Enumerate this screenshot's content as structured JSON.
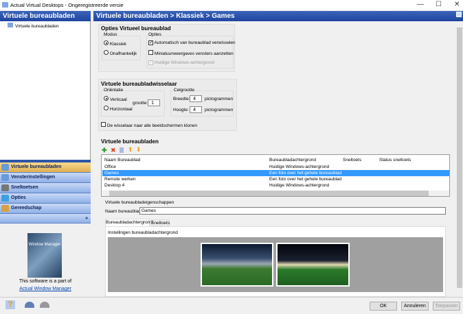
{
  "window": {
    "title": "Actual Virtual Desktops - Ongeregistreerde versie",
    "minimize": "—",
    "maximize": "☐",
    "close": "✕"
  },
  "left": {
    "header": "Virtuele bureaubladen",
    "tree_item": "Virtuele bureaubladen",
    "nav": [
      {
        "label": "Virtuele bureaubladen",
        "selected": true
      },
      {
        "label": "Vensterinstellingen"
      },
      {
        "label": "Sneltoetsen"
      },
      {
        "label": "Opties"
      },
      {
        "label": "Gereedschap"
      }
    ],
    "more": "»",
    "promo_text": "This software is a part of",
    "promo_link": "Actual Window Manager",
    "product_box": "Window Manager"
  },
  "main": {
    "breadcrumb": "Virtuele bureaubladen > Klassiek > Games",
    "group1": {
      "title": "Opties Virtueel bureaublad",
      "modus_label": "Modus",
      "modus_options": [
        "Klassiek",
        "Onafhankelijk"
      ],
      "opties_label": "Opties",
      "options": [
        {
          "label": "Automatisch van bureaublad verwisselen",
          "checked": true
        },
        {
          "label": "Miniatuurweergaves vensters aanzetten",
          "checked": false
        },
        {
          "label": "Huidige Windows-achtergrond",
          "checked": true,
          "disabled": true
        }
      ]
    },
    "group2": {
      "title": "Virtuele bureaubladwisselaar",
      "orient_label": "Oriëntatie",
      "orient_options": [
        "Verticaal",
        "Horizontaal"
      ],
      "size_label": "grootte:",
      "size_value": "1",
      "cell_label": "Celgrootte",
      "width_label": "Breedte:",
      "width_value": "4",
      "height_label": "Hoogte:",
      "height_value": "4",
      "unit": "pictogrammen",
      "clone_label": "De wisselaar naar alle beeldschermen klonen"
    },
    "desktops": {
      "title": "Virtuele bureaubladen",
      "columns": [
        "Naam Bureaublad",
        "Bureaubladachtergrond",
        "Sneltoets",
        "Status sneltoets"
      ],
      "rows": [
        {
          "name": "Office",
          "bg": "Huidige Windows-achtergrond"
        },
        {
          "name": "Games",
          "bg": "Een foto over het gehele bureaublad",
          "selected": true
        },
        {
          "name": "Remote werken",
          "bg": "Een foto over het gehele bureaublad"
        },
        {
          "name": "Desktop 4",
          "bg": "Huidige Windows-achtergrond"
        }
      ]
    },
    "props": {
      "title": "Virtuele bureaubladeigenschappen",
      "name_label": "Naam bureaublad:",
      "name_value": "Games",
      "tabs": [
        "Bureaubladachtergrond",
        "Sneltoets"
      ],
      "bg_group": "Instellingen bureaubladachtergrond"
    }
  },
  "buttons": {
    "ok": "OK",
    "cancel": "Annuleren",
    "apply": "Toepassen"
  }
}
